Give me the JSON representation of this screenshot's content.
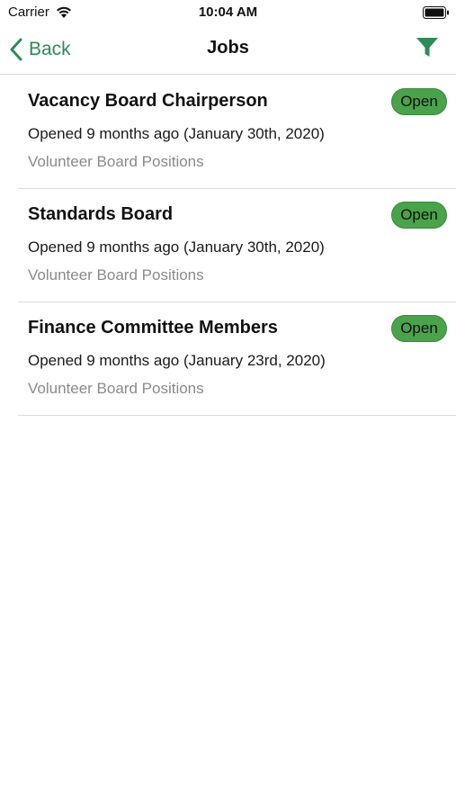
{
  "status_bar": {
    "carrier": "Carrier",
    "time": "10:04 AM",
    "icons": [
      "wifi-icon",
      "battery-icon"
    ]
  },
  "nav": {
    "back_label": "Back",
    "title": "Jobs",
    "filter_icon": "filter-icon",
    "accent_color": "#2e8b57"
  },
  "jobs": [
    {
      "title": "Vacancy Board Chairperson",
      "opened": "Opened 9 months ago (January 30th, 2020)",
      "category": "Volunteer Board Positions",
      "status": "Open"
    },
    {
      "title": "Standards Board",
      "opened": "Opened 9 months ago (January 30th, 2020)",
      "category": "Volunteer Board Positions",
      "status": "Open"
    },
    {
      "title": "Finance Committee Members",
      "opened": "Opened 9 months ago (January 23rd, 2020)",
      "category": "Volunteer Board Positions",
      "status": "Open"
    }
  ],
  "colors": {
    "status_open": "#4aa34a",
    "secondary_text": "#8a8a8a"
  }
}
